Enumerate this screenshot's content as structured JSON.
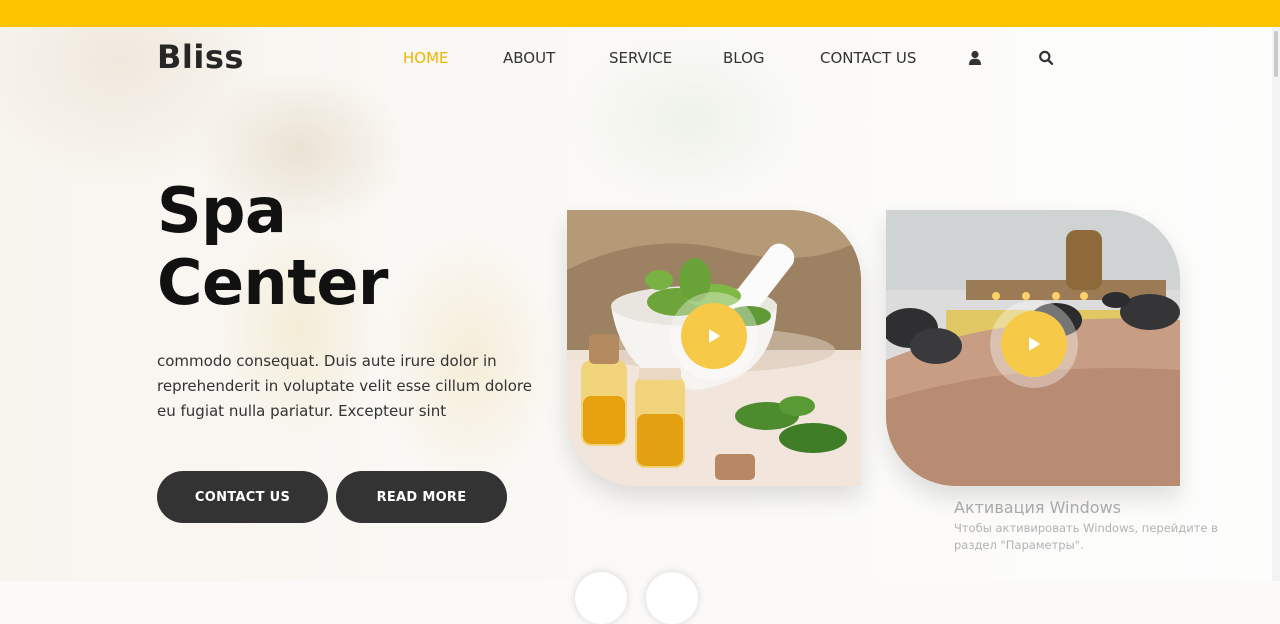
{
  "brand": {
    "logo": "Bliss"
  },
  "colors": {
    "accent": "#ffc400",
    "button_bg": "#333333",
    "play_bg": "#f7c948"
  },
  "nav": {
    "items": [
      {
        "label": "HOME",
        "active": true
      },
      {
        "label": "ABOUT",
        "active": false
      },
      {
        "label": "SERVICE",
        "active": false
      },
      {
        "label": "BLOG",
        "active": false
      },
      {
        "label": "CONTACT US",
        "active": false
      }
    ],
    "icons": [
      "user-icon",
      "search-icon"
    ]
  },
  "hero": {
    "title_line1": "Spa",
    "title_line2": "Center",
    "text": "commodo consequat. Duis aute irure dolor in reprehenderit in voluptate velit esse cillum dolore eu fugiat nulla pariatur. Excepteur sint",
    "buttons": {
      "contact": "CONTACT US",
      "read_more": "READ MORE"
    }
  },
  "cards": [
    {
      "icon": "play-icon"
    },
    {
      "icon": "play-icon"
    }
  ],
  "watermark": {
    "title": "Активация Windows",
    "subtitle": "Чтобы активировать Windows, перейдите в раздел \"Параметры\"."
  }
}
